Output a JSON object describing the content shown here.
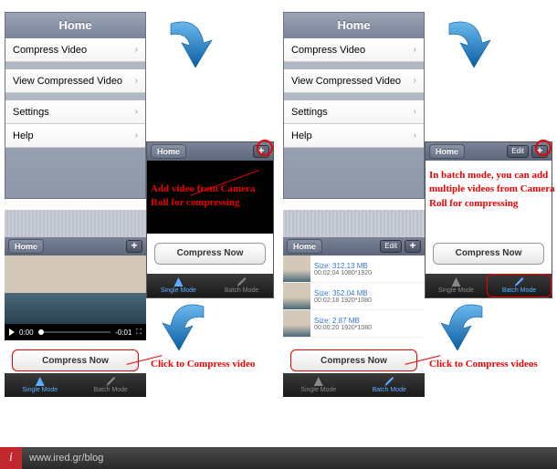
{
  "home": {
    "title": "Home",
    "items": [
      "Compress Video",
      "View Compressed Video",
      "Settings",
      "Help"
    ]
  },
  "mini": {
    "home_label": "Home",
    "edit_label": "Edit",
    "plus": "+",
    "compress_now": "Compress Now"
  },
  "tabs": {
    "single": "Single Mode",
    "batch": "Batch Mode"
  },
  "player": {
    "time_current": "0:00",
    "time_total": "-0:01"
  },
  "videos": [
    {
      "size": "Size: 312.13 MB",
      "meta": "00:02:04  1080*1920"
    },
    {
      "size": "Size: 352.04 MB",
      "meta": "00:02:18  1920*1080"
    },
    {
      "size": "Size: 2.87 MB",
      "meta": "00:00:20  1920*1080"
    }
  ],
  "annot": {
    "add_single": "Add video from Camera Roll for compressing",
    "add_batch": "In batch mode, you can add multiple videos from Camera Roll for compressing",
    "click_single": "Click to Compress video",
    "click_batch": "Click to Compress videos"
  },
  "footer": {
    "icon": "i",
    "url": "www.ired.gr/blog"
  },
  "colors": {
    "arrow": "#1b7dc9",
    "red": "#e00"
  }
}
